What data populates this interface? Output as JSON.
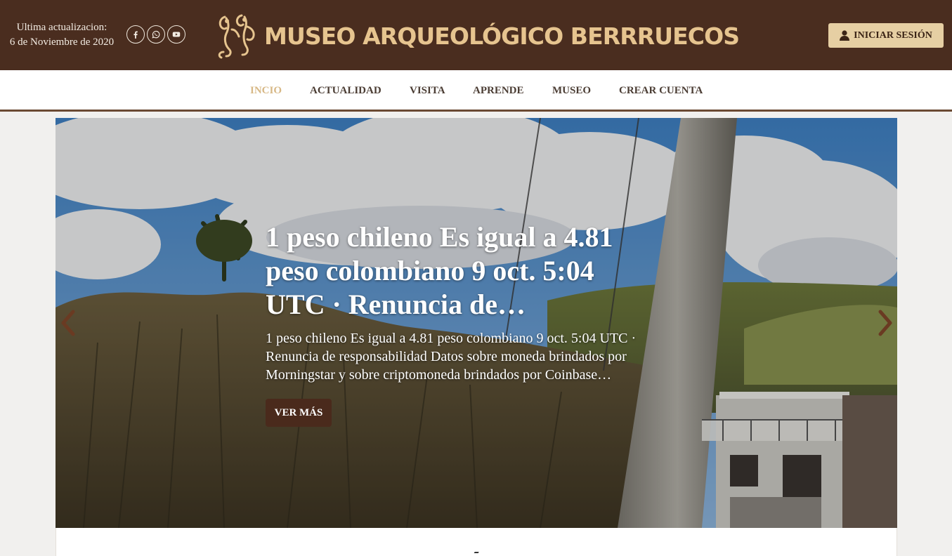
{
  "header": {
    "update_label": "Ultima actualizacion:",
    "update_date": "6 de Noviembre de 2020",
    "site_title": "MUSEO ARQUEOLÓGICO BERRRUECOS",
    "login_label": "INICIAR SESIÓN",
    "socials": [
      "facebook-icon",
      "whatsapp-icon",
      "youtube-icon"
    ]
  },
  "nav": {
    "items": [
      {
        "label": "INCIO",
        "active": true
      },
      {
        "label": "ACTUALIDAD",
        "active": false
      },
      {
        "label": "VISITA",
        "active": false
      },
      {
        "label": "APRENDE",
        "active": false
      },
      {
        "label": "MUSEO",
        "active": false
      },
      {
        "label": "CREAR CUENTA",
        "active": false
      }
    ]
  },
  "hero": {
    "title": "1 peso chileno Es igual a 4.81 peso colombiano 9 oct. 5:04 UTC · Renuncia de…",
    "description": "1 peso chileno Es igual a 4.81 peso colombiano 9 oct. 5:04 UTC · Renuncia de responsabilidad Datos sobre moneda brindados por Morningstar y sobre criptomoneda brindados por Coinbase…",
    "button_label": "VER MÁS",
    "prev_icon": "chevron-left-icon",
    "next_icon": "chevron-right-icon"
  },
  "colors": {
    "header_bg": "#4a2d1f",
    "title_gold": "#e6c48f",
    "nav_active": "#d7b886",
    "button_brown": "#4a2a1c",
    "login_bg": "#e6cfa3"
  }
}
